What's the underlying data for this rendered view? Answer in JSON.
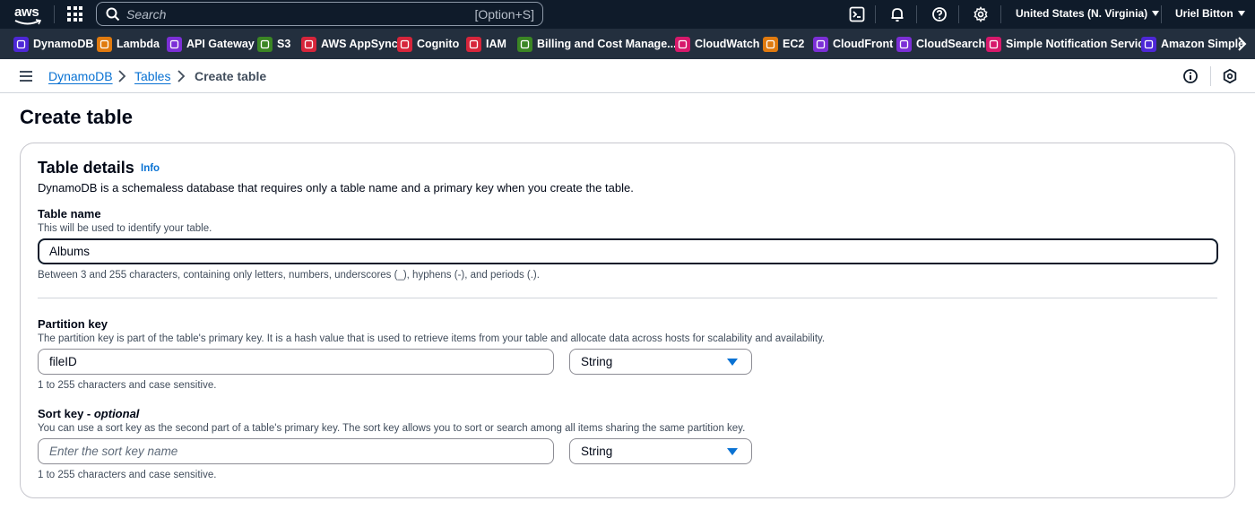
{
  "topnav": {
    "search_placeholder": "Search",
    "search_shortcut": "[Option+S]",
    "region": "United States (N. Virginia)",
    "user": "Uriel Bitton"
  },
  "favorites": [
    {
      "label": "DynamoDB",
      "color": "#4d27d6",
      "icon": "dynamodb-icon"
    },
    {
      "label": "Lambda",
      "color": "#e07a0f",
      "icon": "lambda-icon"
    },
    {
      "label": "API Gateway",
      "color": "#7b2fd6",
      "icon": "api-gateway-icon"
    },
    {
      "label": "S3",
      "color": "#3b8624",
      "icon": "s3-icon"
    },
    {
      "label": "AWS AppSync",
      "color": "#d6253b",
      "icon": "appsync-icon"
    },
    {
      "label": "Cognito",
      "color": "#d6253b",
      "icon": "cognito-icon"
    },
    {
      "label": "IAM",
      "color": "#d6253b",
      "icon": "iam-icon"
    },
    {
      "label": "Billing and Cost Manage...",
      "color": "#3b8624",
      "icon": "billing-icon"
    },
    {
      "label": "CloudWatch",
      "color": "#d6196b",
      "icon": "cloudwatch-icon"
    },
    {
      "label": "EC2",
      "color": "#e07a0f",
      "icon": "ec2-icon"
    },
    {
      "label": "CloudFront",
      "color": "#7b2fd6",
      "icon": "cloudfront-icon"
    },
    {
      "label": "CloudSearch",
      "color": "#7b2fd6",
      "icon": "cloudsearch-icon"
    },
    {
      "label": "Simple Notification Service",
      "color": "#d6196b",
      "icon": "sns-icon"
    },
    {
      "label": "Amazon Simple",
      "color": "#4d27d6",
      "icon": "sqs-icon"
    }
  ],
  "breadcrumb": {
    "items": [
      "DynamoDB",
      "Tables",
      "Create table"
    ]
  },
  "page": {
    "title": "Create table"
  },
  "table_details": {
    "title": "Table details",
    "info": "Info",
    "description": "DynamoDB is a schemaless database that requires only a table name and a primary key when you create the table.",
    "table_name": {
      "label": "Table name",
      "description": "This will be used to identify your table.",
      "value": "Albums",
      "hint": "Between 3 and 255 characters, containing only letters, numbers, underscores (_), hyphens (-), and periods (.)."
    },
    "partition_key": {
      "label": "Partition key",
      "description": "The partition key is part of the table's primary key. It is a hash value that is used to retrieve items from your table and allocate data across hosts for scalability and availability.",
      "value": "fileID",
      "type": "String",
      "hint": "1 to 255 characters and case sensitive."
    },
    "sort_key": {
      "label": "Sort key - ",
      "label_optional": "optional",
      "description": "You can use a sort key as the second part of a table's primary key. The sort key allows you to sort or search among all items sharing the same partition key.",
      "placeholder": "Enter the sort key name",
      "type": "String",
      "hint": "1 to 255 characters and case sensitive."
    }
  }
}
